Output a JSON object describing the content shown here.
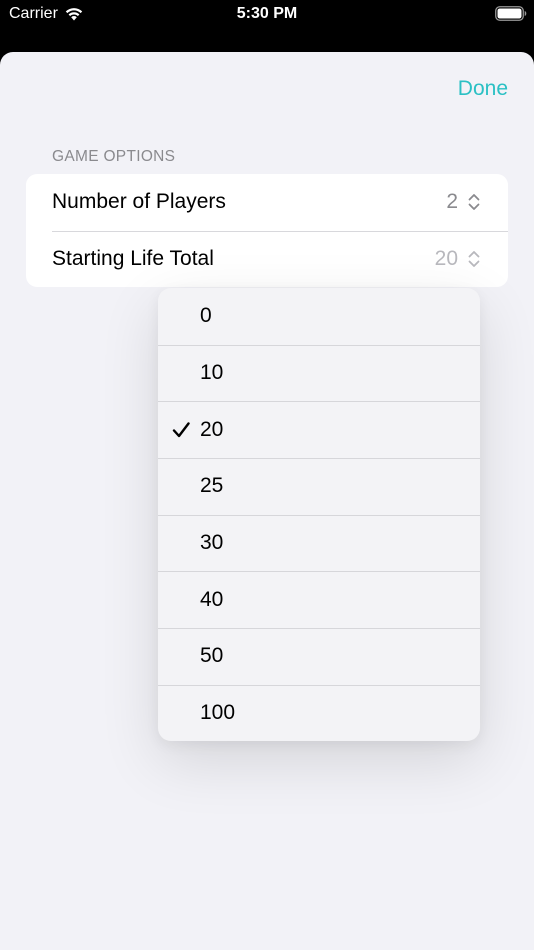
{
  "status_bar": {
    "carrier": "Carrier",
    "time": "5:30 PM"
  },
  "nav": {
    "done_label": "Done",
    "accent_color": "#2bc0c4"
  },
  "section": {
    "header": "GAME OPTIONS",
    "rows": [
      {
        "label": "Number of Players",
        "value": "2",
        "icon": "chevron-up-down-icon"
      },
      {
        "label": "Starting Life Total",
        "value": "20",
        "icon": "chevron-up-down-icon"
      }
    ]
  },
  "menu": {
    "selected": "20",
    "items": [
      {
        "label": "0"
      },
      {
        "label": "10"
      },
      {
        "label": "20",
        "checked": true
      },
      {
        "label": "25"
      },
      {
        "label": "30"
      },
      {
        "label": "40"
      },
      {
        "label": "50"
      },
      {
        "label": "100"
      }
    ]
  }
}
